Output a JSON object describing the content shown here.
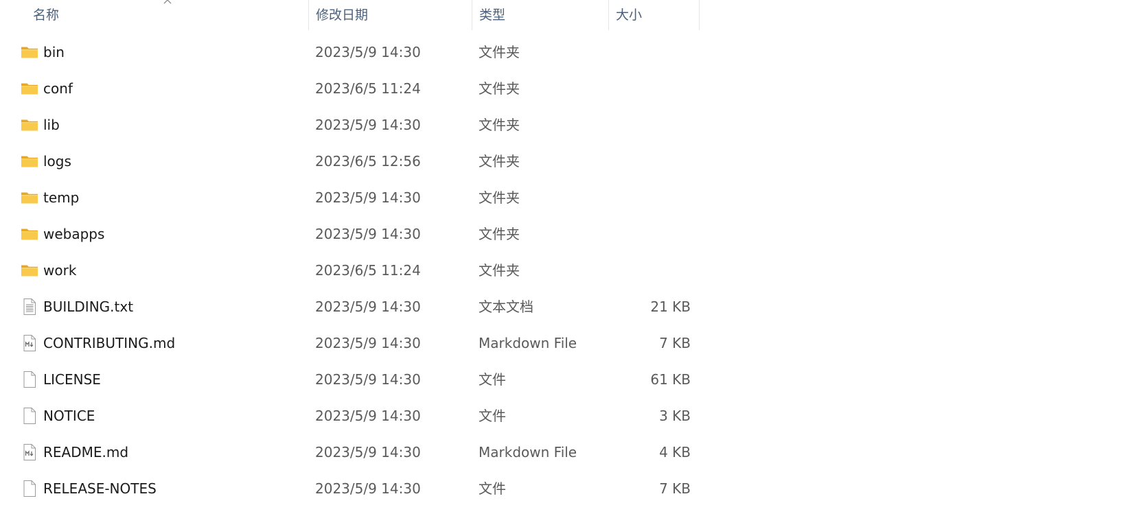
{
  "columns": {
    "name": "名称",
    "date": "修改日期",
    "type": "类型",
    "size": "大小"
  },
  "sort": {
    "column": "name",
    "direction": "ascending"
  },
  "colors": {
    "folder": "#f8c94a",
    "header_text": "#4c607a",
    "secondary_text": "#5a5a5a"
  },
  "files": [
    {
      "name": "bin",
      "date": "2023/5/9 14:30",
      "type": "文件夹",
      "size": "",
      "icon": "folder-icon"
    },
    {
      "name": "conf",
      "date": "2023/6/5 11:24",
      "type": "文件夹",
      "size": "",
      "icon": "folder-icon"
    },
    {
      "name": "lib",
      "date": "2023/5/9 14:30",
      "type": "文件夹",
      "size": "",
      "icon": "folder-icon"
    },
    {
      "name": "logs",
      "date": "2023/6/5 12:56",
      "type": "文件夹",
      "size": "",
      "icon": "folder-icon"
    },
    {
      "name": "temp",
      "date": "2023/5/9 14:30",
      "type": "文件夹",
      "size": "",
      "icon": "folder-icon"
    },
    {
      "name": "webapps",
      "date": "2023/5/9 14:30",
      "type": "文件夹",
      "size": "",
      "icon": "folder-icon"
    },
    {
      "name": "work",
      "date": "2023/6/5 11:24",
      "type": "文件夹",
      "size": "",
      "icon": "folder-icon"
    },
    {
      "name": "BUILDING.txt",
      "date": "2023/5/9 14:30",
      "type": "文本文档",
      "size": "21 KB",
      "icon": "text-file-icon"
    },
    {
      "name": "CONTRIBUTING.md",
      "date": "2023/5/9 14:30",
      "type": "Markdown File",
      "size": "7 KB",
      "icon": "markdown-file-icon"
    },
    {
      "name": "LICENSE",
      "date": "2023/5/9 14:30",
      "type": "文件",
      "size": "61 KB",
      "icon": "file-icon"
    },
    {
      "name": "NOTICE",
      "date": "2023/5/9 14:30",
      "type": "文件",
      "size": "3 KB",
      "icon": "file-icon"
    },
    {
      "name": "README.md",
      "date": "2023/5/9 14:30",
      "type": "Markdown File",
      "size": "4 KB",
      "icon": "markdown-file-icon"
    },
    {
      "name": "RELEASE-NOTES",
      "date": "2023/5/9 14:30",
      "type": "文件",
      "size": "7 KB",
      "icon": "file-icon"
    }
  ]
}
